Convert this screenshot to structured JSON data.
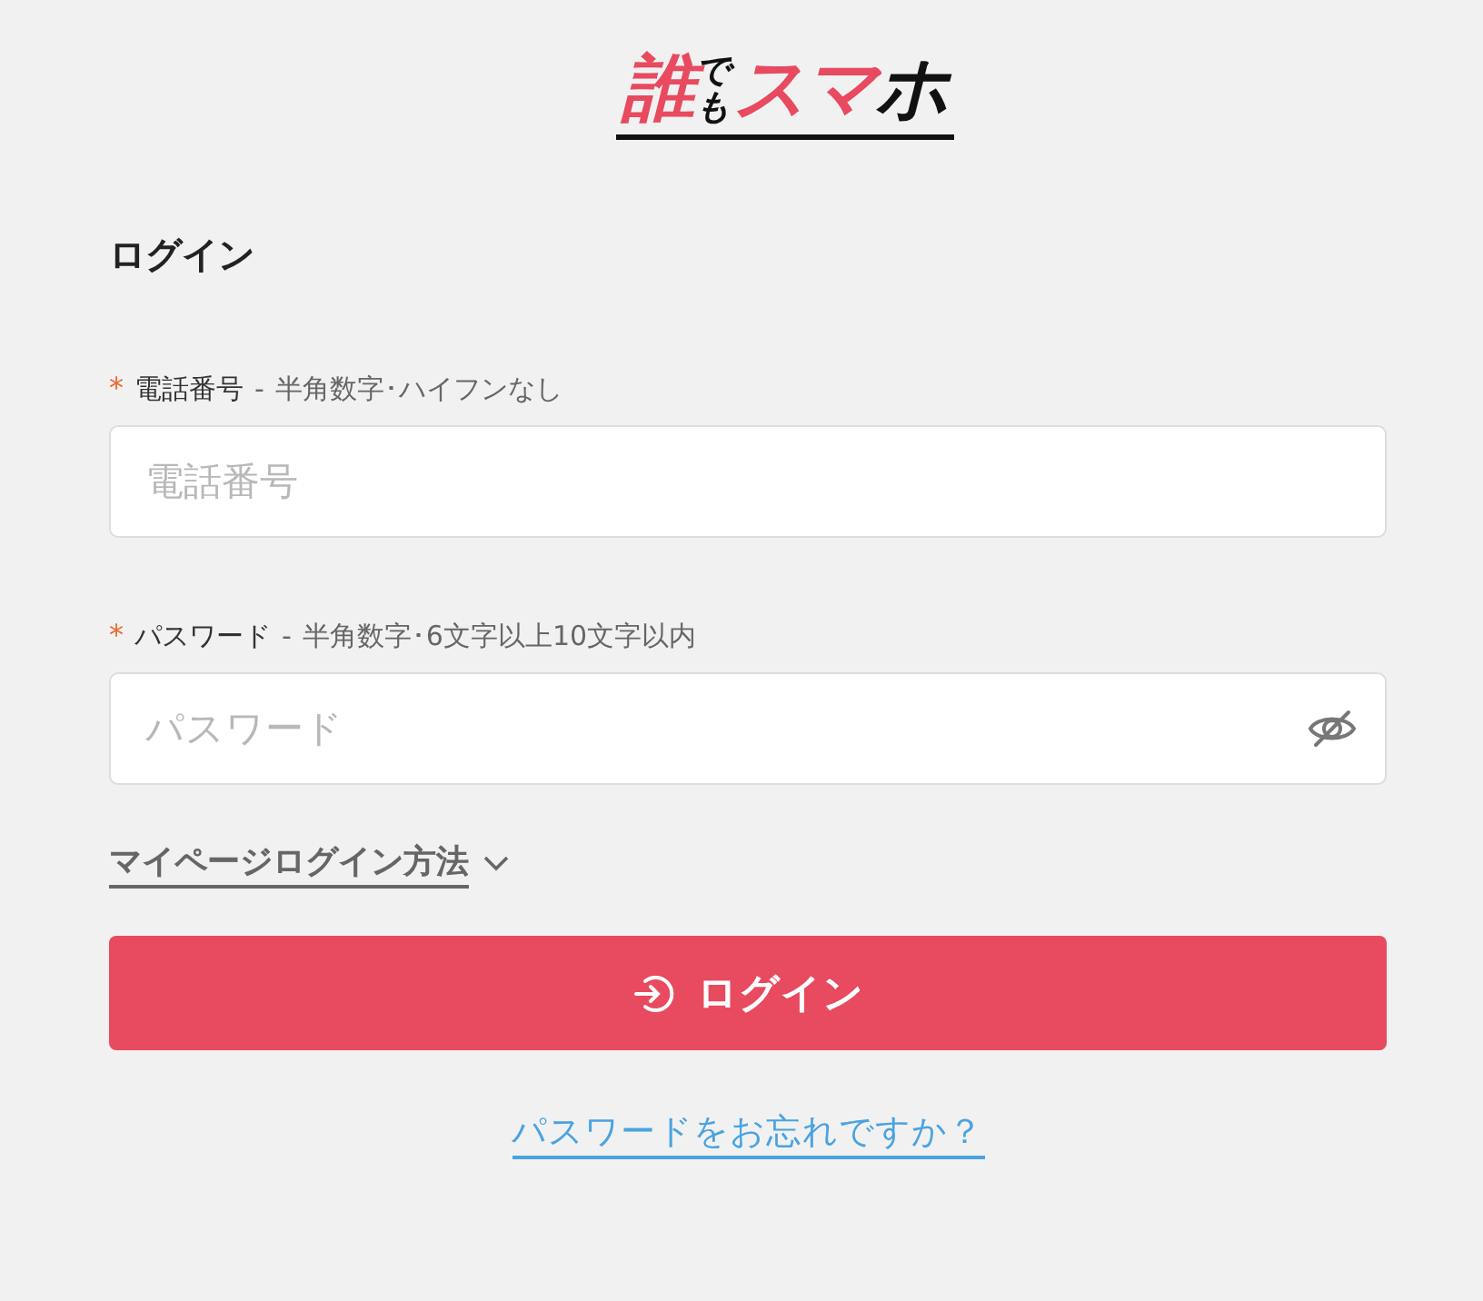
{
  "logo": {
    "segments": [
      {
        "text": "誰",
        "color": "#e84a5f",
        "stacked": false
      },
      {
        "text": "でも",
        "color": "#111111",
        "stacked": true
      },
      {
        "text": "スマ",
        "color": "#e84a5f",
        "stacked": false
      },
      {
        "text": "ホ",
        "color": "#111111",
        "stacked": false
      }
    ]
  },
  "title": "ログイン",
  "fields": [
    {
      "kind": "text",
      "required_mark": "*",
      "label": "電話番号",
      "separator": "-",
      "hint": "半角数字･ハイフンなし",
      "placeholder": "電話番号"
    },
    {
      "kind": "password",
      "required_mark": "*",
      "label": "パスワード",
      "separator": "-",
      "hint": "半角数字･6文字以上10文字以内",
      "placeholder": "パスワード"
    }
  ],
  "login_method": {
    "label": "マイページログイン方法",
    "expanded": false
  },
  "login_button": "ログイン",
  "forgot_link": "パスワードをお忘れですか？"
}
